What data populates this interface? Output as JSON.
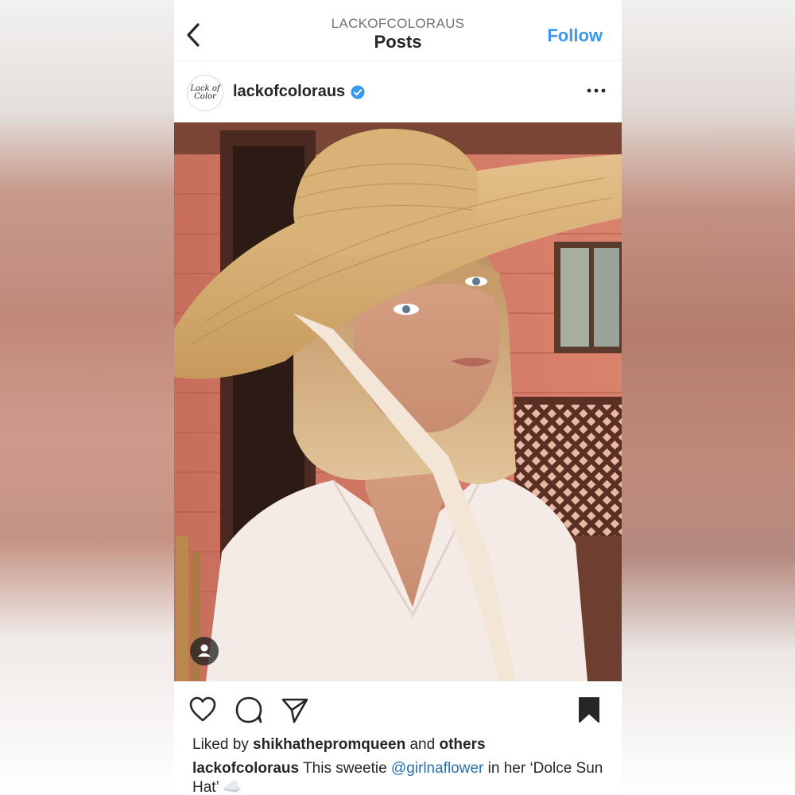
{
  "nav": {
    "account_handle": "LACKOFCOLORAUS",
    "title": "Posts",
    "follow_label": "Follow",
    "back_icon": "chevron-left-icon"
  },
  "post": {
    "avatar_text_line1": "Lack of",
    "avatar_text_line2": "Color",
    "username": "lackofcoloraus",
    "verified_icon": "verified-badge-icon",
    "more_icon": "more-horizontal-icon",
    "photo_alt": "woman wearing wide straw sun hat",
    "tag_icon": "user-tag-icon"
  },
  "actions": {
    "like_icon": "heart-icon",
    "comment_icon": "comment-icon",
    "share_icon": "send-icon",
    "save_icon": "bookmark-icon"
  },
  "likes": {
    "prefix": "Liked by ",
    "user": "shikhathepromqueen",
    "middle": " and ",
    "others": "others"
  },
  "caption": {
    "user": "lackofcoloraus",
    "text_before": " This sweetie ",
    "mention": "@girlnaflower",
    "text_after": " in her ‘Dolce Sun Hat’ ☁️"
  },
  "colors": {
    "accent": "#3897f0",
    "text": "#262626",
    "muted": "#737373"
  }
}
